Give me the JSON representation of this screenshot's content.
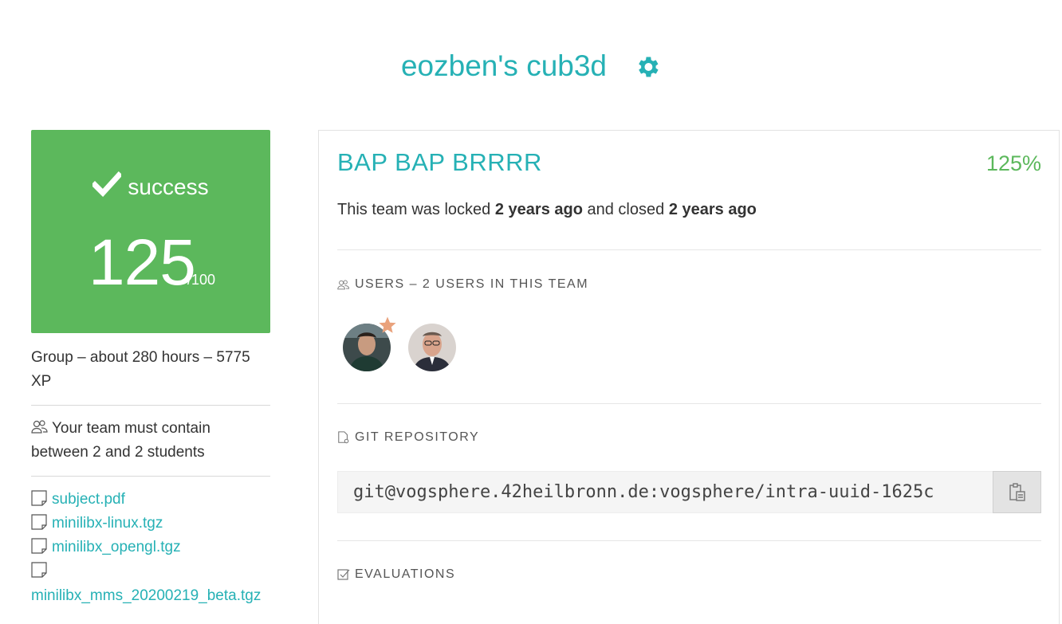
{
  "header": {
    "title": "eozben's cub3d",
    "settings_icon": "gear-icon"
  },
  "score": {
    "status": "success",
    "status_icon": "checkmark-icon",
    "value": "125",
    "max": "/100",
    "color": "#5cb85c"
  },
  "project_meta": {
    "text": "Group – about 280 hours – 5775 XP"
  },
  "team_size": {
    "icon": "users-icon",
    "text": "Your team must contain between 2 and 2 students"
  },
  "attachments": [
    {
      "name": "subject.pdf",
      "icon": "file-icon"
    },
    {
      "name": "minilibx-linux.tgz",
      "icon": "file-icon"
    },
    {
      "name": "minilibx_opengl.tgz",
      "icon": "file-icon"
    },
    {
      "name": "minilibx_mms_20200219_beta.tgz",
      "icon": "file-icon"
    }
  ],
  "team": {
    "name": "BAP BAP BRRRR",
    "percentage": "125%",
    "status_prefix": "This team was locked",
    "locked_ago": "2 years ago",
    "status_middle": "and closed",
    "closed_ago": "2 years ago"
  },
  "users_section": {
    "title": "USERS – 2 USERS IN THIS TEAM",
    "icon": "users-icon"
  },
  "users": [
    {
      "icon": "avatar",
      "leader": true
    },
    {
      "icon": "avatar",
      "leader": false
    }
  ],
  "git_section": {
    "title": "GIT REPOSITORY",
    "icon": "repo-icon"
  },
  "git": {
    "url": "git@vogsphere.42heilbronn.de:vogsphere/intra-uuid-1625c",
    "copy_icon": "clipboard-icon"
  },
  "evaluations_section": {
    "title": "EVALUATIONS",
    "icon": "checkbox-icon"
  },
  "colors": {
    "accent": "#26b1b5",
    "success": "#5cb85c",
    "star": "#e9a27c"
  }
}
